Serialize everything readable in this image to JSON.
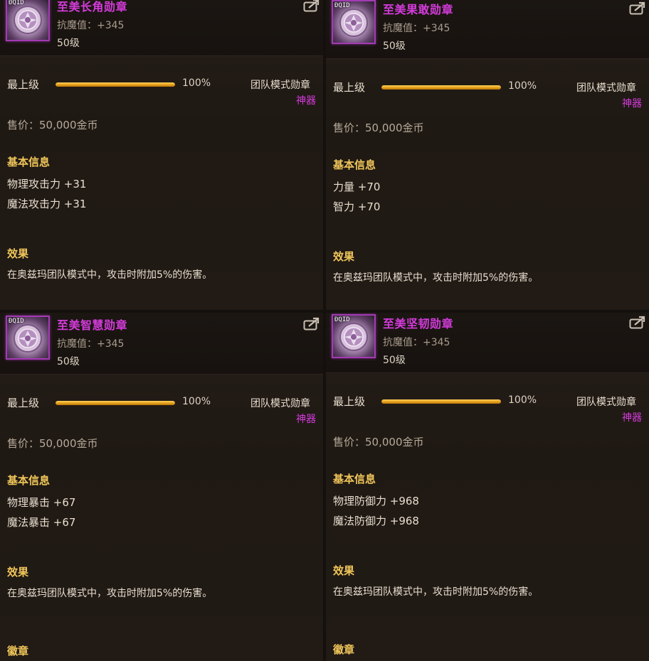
{
  "items": [
    {
      "icon_tag": "ÐQID",
      "icon": "medal-icon",
      "name": "至美长角勋章",
      "resist": "抗魔值：+345",
      "level": "50级",
      "grade_label": "最上级",
      "grade_progress": 1.0,
      "grade_pct": "100%",
      "mode": "团队模式勋章",
      "rarity": "神器",
      "price": "售价：50,000金币",
      "basic_title": "基本信息",
      "stats": [
        "物理攻击力 +31",
        "魔法攻击力 +31"
      ],
      "effect_title": "效果",
      "effect_text": "在奥兹玛团队模式中，攻击时附加5%的伤害。",
      "footer_title": ""
    },
    {
      "icon_tag": "ÐQID",
      "icon": "medal-icon",
      "name": "至美果敢勋章",
      "resist": "抗魔值：+345",
      "level": "50级",
      "grade_label": "最上级",
      "grade_progress": 1.0,
      "grade_pct": "100%",
      "mode": "团队模式勋章",
      "rarity": "神器",
      "price": "售价：50,000金币",
      "basic_title": "基本信息",
      "stats": [
        "力量 +70",
        "智力 +70"
      ],
      "effect_title": "效果",
      "effect_text": "在奥兹玛团队模式中，攻击时附加5%的伤害。",
      "footer_title": ""
    },
    {
      "icon_tag": "ÐQID",
      "icon": "medal-icon",
      "name": "至美智慧勋章",
      "resist": "抗魔值：+345",
      "level": "50级",
      "grade_label": "最上级",
      "grade_progress": 1.0,
      "grade_pct": "100%",
      "mode": "团队模式勋章",
      "rarity": "神器",
      "price": "售价：50,000金币",
      "basic_title": "基本信息",
      "stats": [
        "物理暴击 +67",
        "魔法暴击 +67"
      ],
      "effect_title": "效果",
      "effect_text": "在奥兹玛团队模式中，攻击时附加5%的伤害。",
      "footer_title": "徽章"
    },
    {
      "icon_tag": "ÐQID",
      "icon": "medal-icon",
      "name": "至美坚韧勋章",
      "resist": "抗魔值：+345",
      "level": "50级",
      "grade_label": "最上级",
      "grade_progress": 1.0,
      "grade_pct": "100%",
      "mode": "团队模式勋章",
      "rarity": "神器",
      "price": "售价：50,000金币",
      "basic_title": "基本信息",
      "stats": [
        "物理防御力 +968",
        "魔法防御力 +968"
      ],
      "effect_title": "效果",
      "effect_text": "在奥兹玛团队模式中，攻击时附加5%的伤害。",
      "footer_title": "徽章"
    }
  ],
  "colors": {
    "item_name": "#d53bdc",
    "section_title": "#f0c65a",
    "bar_fill": "#f2b632",
    "background": "#211a15"
  }
}
